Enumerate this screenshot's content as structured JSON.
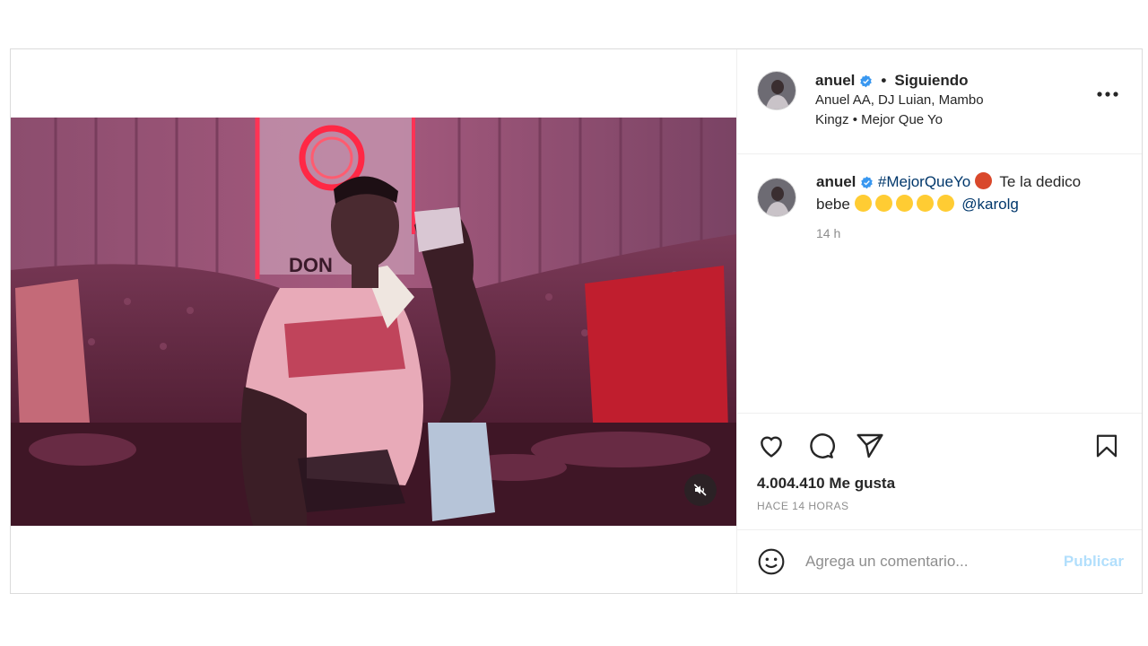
{
  "header": {
    "username": "anuel",
    "separator": "•",
    "follow_status": "Siguiendo",
    "music": "Anuel AA, DJ Luian, Mambo Kingz • Mejor Que Yo"
  },
  "caption": {
    "username": "anuel",
    "hashtag": "#MejorQueYo",
    "text_part1": "Te la dedico bebe",
    "mention": "@karolg",
    "time": "14 h"
  },
  "stats": {
    "likes": "4.004.410 Me gusta",
    "posted": "HACE 14 HORAS"
  },
  "comment": {
    "placeholder": "Agrega un comentario...",
    "publish_label": "Publicar"
  },
  "video": {
    "sign_text": "DON"
  },
  "icons": {
    "verified": "verified-badge-icon",
    "more": "more-options-icon",
    "like": "heart-icon",
    "comment": "comment-icon",
    "share": "share-icon",
    "save": "bookmark-icon",
    "emoji": "emoji-icon",
    "mute": "muted-speaker-icon"
  },
  "colors": {
    "verified": "#3897f0",
    "link": "#00376b",
    "publish": "#b2dffc",
    "muted_text": "#8e8e8e"
  }
}
